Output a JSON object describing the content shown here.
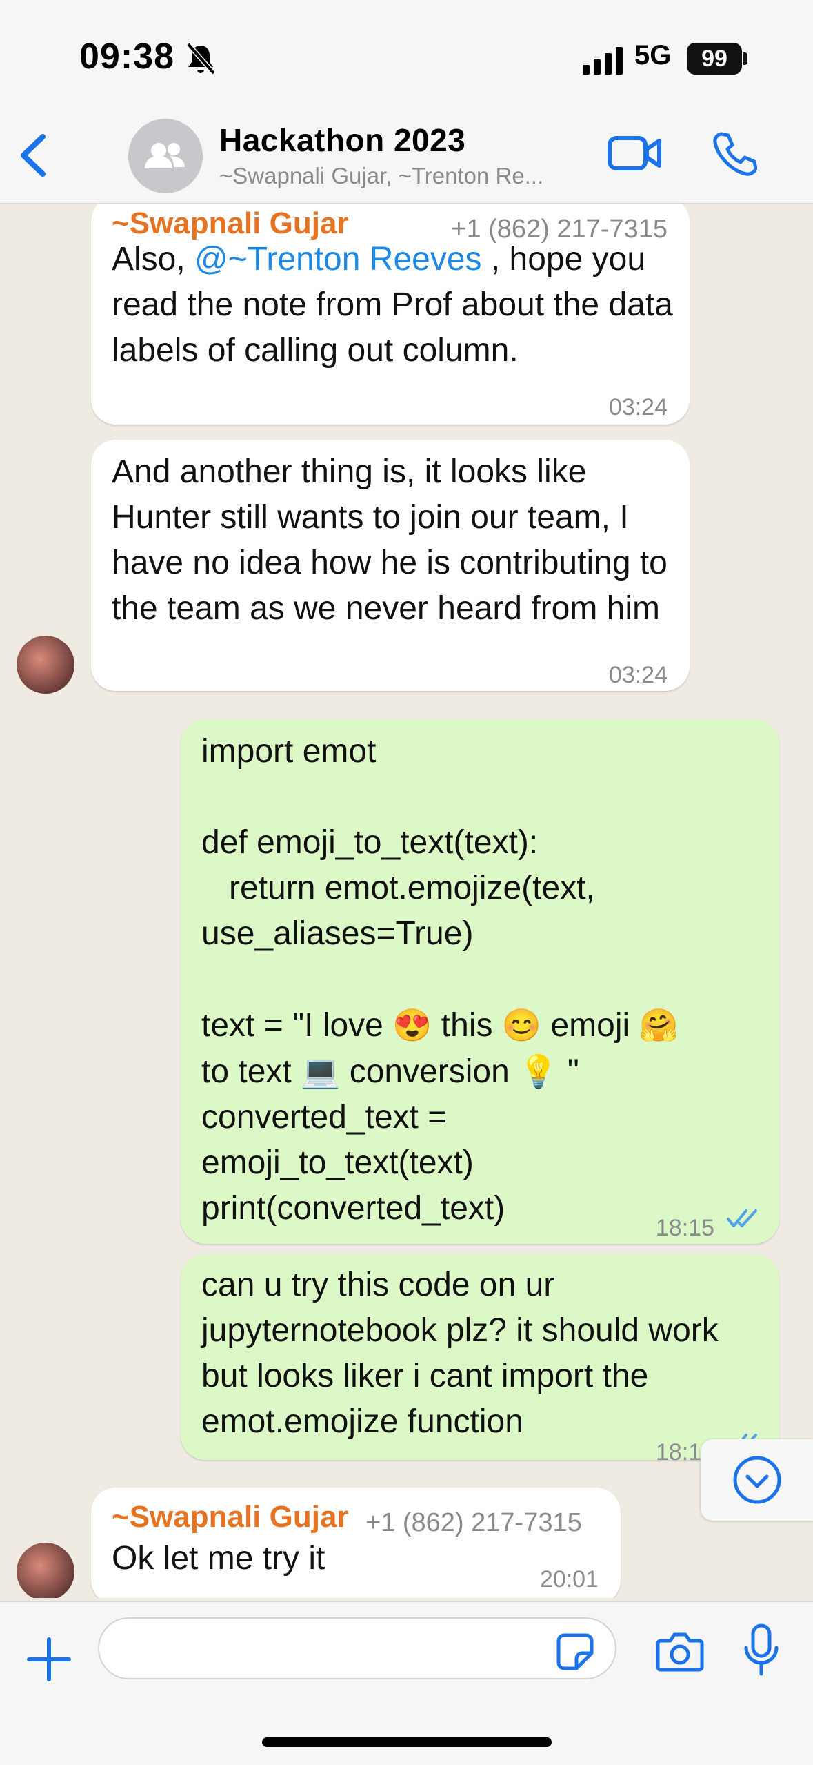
{
  "status_bar": {
    "time": "09:38",
    "network": "5G",
    "battery": "99"
  },
  "header": {
    "title": "Hackathon 2023",
    "subtitle": "~Swapnali Gujar, ~Trenton Re..."
  },
  "messages": [
    {
      "sender": "~Swapnali Gujar",
      "phone": "+1 (862) 217-7315",
      "text_before": "Also, ",
      "mention": "@~Trenton Reeves",
      "text_after": " , hope you read the note from Prof about the data labels of calling out column.",
      "time": "03:24"
    },
    {
      "text": "And another thing is, it looks like Hunter still wants to join our team, I have no idea how he is contributing to the team as we never heard from him",
      "time": "03:24"
    },
    {
      "code_line1": "import emot",
      "code_line2": "def emoji_to_text(text):",
      "code_line3": "   return emot.emojize(text,",
      "code_line4": "use_aliases=True)",
      "code_line5a": "text = \"I love ",
      "emoji1": "😍",
      "code_line5b": " this ",
      "emoji2": "😊",
      "code_line5c": " emoji ",
      "emoji3": "🤗",
      "code_line6a": "to text ",
      "emoji4": "💻",
      "code_line6b": " conversion ",
      "emoji5": "💡",
      "code_line6c": " \"",
      "code_line7": "converted_text =",
      "code_line8": "emoji_to_text(text)",
      "code_line9": "print(converted_text)",
      "time": "18:15"
    },
    {
      "text": "can u try this code on ur jupyternotebook plz? it should work but looks liker i cant import the emot.emojize function",
      "time": "18:16"
    },
    {
      "sender": "~Swapnali Gujar",
      "phone": "+1 (862) 217-7315",
      "text": "Ok let me try it",
      "time": "20:01"
    }
  ],
  "input": {
    "placeholder": ""
  },
  "colors": {
    "accent": "#1a73e8",
    "sender": "#e67322",
    "outgoing": "#dcf8c6",
    "incoming": "#ffffff"
  }
}
